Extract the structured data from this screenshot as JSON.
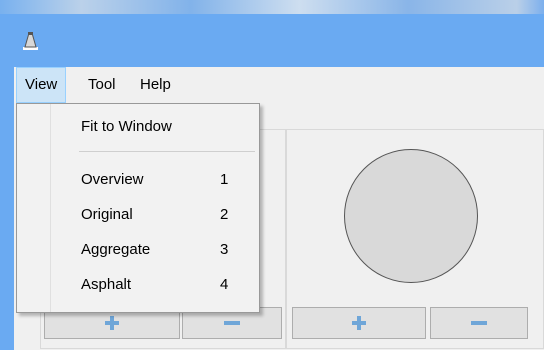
{
  "window": {
    "app_icon": "app-icon"
  },
  "menubar": {
    "items": [
      {
        "label": "View"
      },
      {
        "label": "Tool"
      },
      {
        "label": "Help"
      }
    ]
  },
  "view_menu": {
    "items": [
      {
        "label": "Fit to Window",
        "shortcut": ""
      },
      {
        "label": "Overview",
        "shortcut": "1"
      },
      {
        "label": "Original",
        "shortcut": "2"
      },
      {
        "label": "Aggregate",
        "shortcut": "3"
      },
      {
        "label": "Asphalt",
        "shortcut": "4"
      }
    ]
  },
  "buttons": {
    "icons": [
      "plus-icon",
      "minus-icon",
      "plus-icon",
      "minus-icon"
    ]
  },
  "colors": {
    "titlebar": "#6aaaf2",
    "menu_highlight": "#cce4f7",
    "button_icon": "#6fa6d8"
  }
}
